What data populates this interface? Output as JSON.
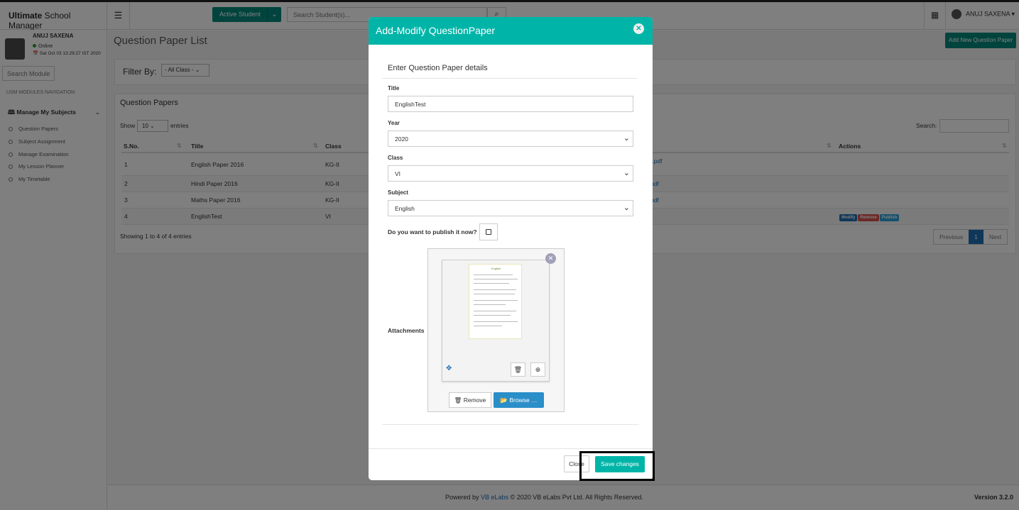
{
  "app": {
    "brand_bold": "Ultimate",
    "brand_rest": " School Manager",
    "menu_icon": "☰"
  },
  "topbar": {
    "active_student_label": "Active Student",
    "search_placeholder": "Search Student(s)...",
    "apps_icon": "▦",
    "user_label": "ANUJ SAXENA ▾"
  },
  "sidebar": {
    "user_name": "ANUJ SAXENA",
    "status": "Online",
    "date": "Sat Oct 03 13:29:27 IST 2020",
    "search_placeholder": "Search Modules...",
    "nav_header": "USM MODULES NAVIGATION",
    "group_label": "Manage My Subjects",
    "items": [
      "Question Papers",
      "Subject Assignment",
      "Manage Examination",
      "My Lesson Planner",
      "My Timetable"
    ]
  },
  "page": {
    "title": "Question Paper List",
    "add_button": "Add New Question Paper",
    "filter_label": "Filter By:",
    "filter_value": "- All Class -"
  },
  "table": {
    "panel_title": "Question Papers",
    "show_label": "Show",
    "show_value": "10",
    "entries_label": "entries",
    "search_label": "Search:",
    "headers": [
      "S.No.",
      "Title",
      "Class",
      "Actions"
    ],
    "rows": [
      {
        "sno": "1",
        "title": "English Paper 2016",
        "cls": "KG-II",
        "file": "t.pdf"
      },
      {
        "sno": "2",
        "title": "Hindi Paper 2016",
        "cls": "KG-II",
        "file": "pdf"
      },
      {
        "sno": "3",
        "title": "Maths Paper 2016",
        "cls": "KG-II",
        "file": "pdf"
      },
      {
        "sno": "4",
        "title": "EnglishTest",
        "cls": "VI",
        "file": ""
      }
    ],
    "actions": [
      "Modify",
      "Remove",
      "Publish"
    ],
    "info": "Showing 1 to 4 of 4 entries",
    "pager": {
      "prev": "Previous",
      "current": "1",
      "next": "Next"
    }
  },
  "footer": {
    "text": "Powered by",
    "link": "VB eLabs",
    "rest": "© 2020 VB eLabs Pvt Ltd. All Rights Reserved.",
    "version": "Version 3.2.0"
  },
  "modal": {
    "title": "Add-Modify QuestionPaper",
    "close_icon": "✕",
    "legend": "Enter Question Paper details",
    "title_label": "Title",
    "title_value": "EnglishTest",
    "year_label": "Year",
    "year_value": "2020",
    "class_label": "Class",
    "class_value": "VI",
    "subject_label": "Subject",
    "subject_value": "English",
    "publish_label": "Do you want to publish it now?",
    "attachments_label": "Attachments",
    "doc_title": "English",
    "remove_label": "🗑 Remove",
    "browse_label": "📂 Browse …",
    "close_label": "Close",
    "save_label": "Save changes"
  },
  "colors": {
    "accent": "#00b5a8",
    "primary": "#1e6fb3",
    "brand_green": "#00897b",
    "modify": "#1e6fb3",
    "remove": "#d9534f",
    "publish": "#2aa3d8"
  }
}
